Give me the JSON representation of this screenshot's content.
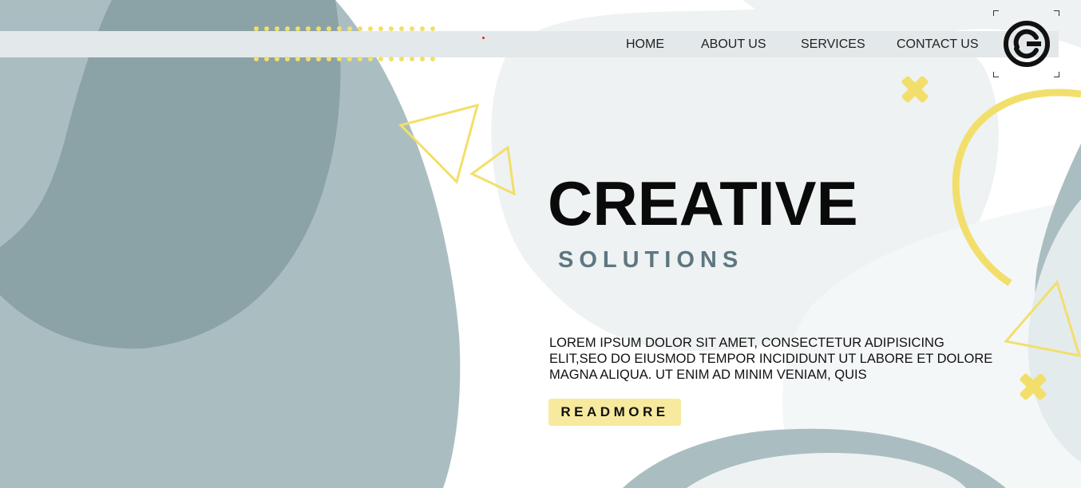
{
  "header": {
    "nav_items": [
      {
        "label": "HOME"
      },
      {
        "label": "ABOUT US"
      },
      {
        "label": "SERVICES"
      },
      {
        "label": "CONTACT US"
      }
    ]
  },
  "hero": {
    "title": "CREATIVE",
    "subtitle": "SOLUTIONS",
    "body": "LOREM IPSUM DOLOR SIT AMET, CONSECTETUR ADIPISICING ELIT,SEO DO EIUSMOD TEMPOR INCIDIDUNT UT LABORE ET DOLORE MAGNA ALIQUA. UT ENIM AD MINIM VENIAM, QUIS",
    "button_label": "READMORE"
  },
  "colors": {
    "accent_yellow": "#f2df6b",
    "button_yellow": "#f7ea9e",
    "blob_dark": "#8ba2a7",
    "blob_mid": "#aabec2",
    "blob_light": "#eef2f3",
    "subtitle": "#5e7680",
    "nav_bar": "#e3e8ea"
  },
  "icons": {
    "logo": "circle-c-logo-icon",
    "decor_cross": "x-cross-icon",
    "decor_triangle": "triangle-outline-icon",
    "decor_ring": "ring-icon"
  }
}
